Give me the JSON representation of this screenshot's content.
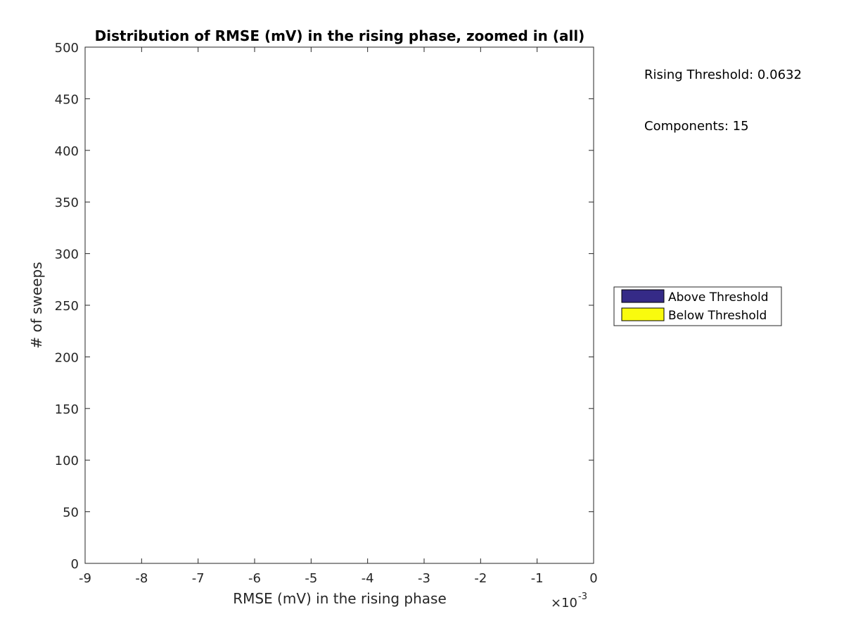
{
  "chart_data": {
    "type": "bar",
    "title": "Distribution of RMSE (mV) in the rising phase, zoomed in (all)",
    "xlabel": "RMSE (mV) in the rising phase",
    "ylabel": "# of sweeps",
    "x_exponent_base": "×10",
    "x_exponent_power": "-3",
    "xlim": [
      -9,
      0
    ],
    "ylim": [
      0,
      500
    ],
    "xticks": [
      -9,
      -8,
      -7,
      -6,
      -5,
      -4,
      -3,
      -2,
      -1,
      0
    ],
    "xtick_labels": [
      "-9",
      "-8",
      "-7",
      "-6",
      "-5",
      "-4",
      "-3",
      "-2",
      "-1",
      "0"
    ],
    "yticks": [
      0,
      50,
      100,
      150,
      200,
      250,
      300,
      350,
      400,
      450,
      500
    ],
    "ytick_labels": [
      "0",
      "50",
      "100",
      "150",
      "200",
      "250",
      "300",
      "350",
      "400",
      "450",
      "500"
    ],
    "grid": false,
    "series": [
      {
        "name": "Above Threshold",
        "color": "#352a87",
        "values": []
      },
      {
        "name": "Below Threshold",
        "color": "#f9fb0e",
        "values": []
      }
    ],
    "legend_position": "right",
    "annotations": [
      "Rising Threshold: 0.0632",
      "Components: 15"
    ]
  }
}
